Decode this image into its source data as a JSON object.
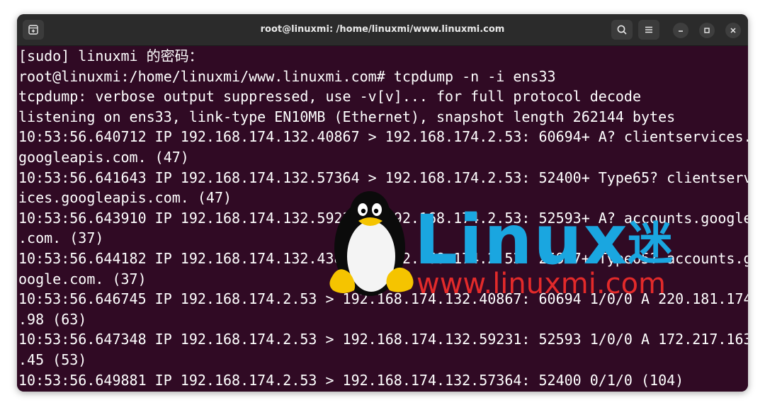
{
  "window": {
    "title": "root@linuxmi: /home/linuxmi/www.linuxmi.com"
  },
  "terminal": {
    "lines": [
      "[sudo] linuxmi 的密码：",
      "root@linuxmi:/home/linuxmi/www.linuxmi.com# tcpdump -n -i ens33",
      "tcpdump: verbose output suppressed, use -v[v]... for full protocol decode",
      "listening on ens33, link-type EN10MB (Ethernet), snapshot length 262144 bytes",
      "10:53:56.640712 IP 192.168.174.132.40867 > 192.168.174.2.53: 60694+ A? clientservices.",
      "googleapis.com. (47)",
      "10:53:56.641643 IP 192.168.174.132.57364 > 192.168.174.2.53: 52400+ Type65? clientserv",
      "ices.googleapis.com. (47)",
      "10:53:56.643910 IP 192.168.174.132.59231 > 192.168.174.2.53: 52593+ A? accounts.google",
      ".com. (37)",
      "10:53:56.644182 IP 192.168.174.132.43871 > 192.168.174.2.53: 25917+ Type65? accounts.g",
      "oogle.com. (37)",
      "10:53:56.646745 IP 192.168.174.2.53 > 192.168.174.132.40867: 60694 1/0/0 A 220.181.174",
      ".98 (63)",
      "10:53:56.647348 IP 192.168.174.2.53 > 192.168.174.132.59231: 52593 1/0/0 A 172.217.163",
      ".45 (53)",
      "10:53:56.649881 IP 192.168.174.2.53 > 192.168.174.132.57364: 52400 0/1/0 (104)"
    ]
  },
  "watermark": {
    "brand": "Linux",
    "brand_cjk": "迷",
    "url": "www.linuxmi.com"
  },
  "colors": {
    "terminal_bg": "#300a24",
    "titlebar_bg": "#2b2b2b",
    "text": "#ffffff",
    "brand_blue": "#1aa6e0",
    "brand_red": "#e32a2a"
  },
  "icons": {
    "new_tab": "new-tab-icon",
    "search": "search-icon",
    "menu": "hamburger-menu-icon",
    "minimize": "minimize-icon",
    "maximize": "maximize-icon",
    "close": "close-icon"
  }
}
